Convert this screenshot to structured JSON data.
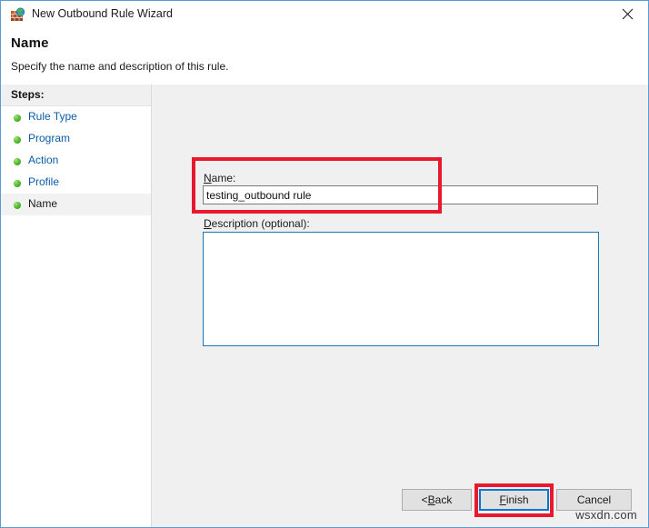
{
  "window": {
    "title": "New Outbound Rule Wizard",
    "icon": "firewall-wall-globe-icon",
    "close_label": "✕",
    "border_color": "#5a9bd5"
  },
  "header": {
    "title": "Name",
    "subtitle": "Specify the name and description of this rule."
  },
  "sidebar": {
    "header": "Steps:",
    "items": [
      {
        "label": "Rule Type",
        "state": "completed"
      },
      {
        "label": "Program",
        "state": "completed"
      },
      {
        "label": "Action",
        "state": "completed"
      },
      {
        "label": "Profile",
        "state": "completed"
      },
      {
        "label": "Name",
        "state": "current"
      }
    ],
    "bullet_color": "#5bc236",
    "link_color": "#0b5ca8"
  },
  "form": {
    "name_label_prefix": "N",
    "name_label_rest": "ame:",
    "name_value": "testing_outbound rule",
    "name_placeholder": "",
    "description_label_prefix": "D",
    "description_label_rest": "escription (optional):",
    "description_value": "",
    "description_placeholder": ""
  },
  "buttons": {
    "back_prefix": "< ",
    "back_accel": "B",
    "back_rest": "ack",
    "finish_prefix": "",
    "finish_accel": "F",
    "finish_rest": "inish",
    "cancel": "Cancel",
    "focus_color": "#0078d7"
  },
  "annotations": {
    "color": "#e8192c",
    "highlighted": [
      "name-field",
      "finish-button"
    ]
  },
  "watermark": {
    "text": "wsxdn.com"
  }
}
